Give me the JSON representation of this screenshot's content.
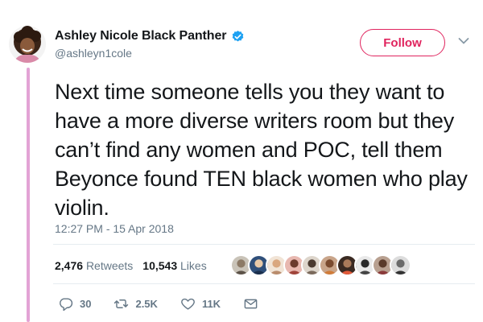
{
  "user": {
    "display_name": "Ashley Nicole Black Panther",
    "handle": "@ashleyn1cole"
  },
  "follow_label": "Follow",
  "tweet": {
    "text": "Next time someone tells you they want to have a more diverse writers room but they can’t find any women and POC, tell them Beyonce found TEN black women who play violin.",
    "timestamp": "12:27 PM - 15 Apr 2018"
  },
  "stats": {
    "retweets_count": "2,476",
    "retweets_label": "Retweets",
    "likes_count": "10,543",
    "likes_label": "Likes"
  },
  "actions": {
    "replies": "30",
    "retweets": "2.5K",
    "likes": "11K"
  },
  "colors": {
    "follow_accent": "#e0245e",
    "verified": "#1da1f2",
    "thread_line": "#e3a3d5",
    "muted_text": "#657786"
  }
}
